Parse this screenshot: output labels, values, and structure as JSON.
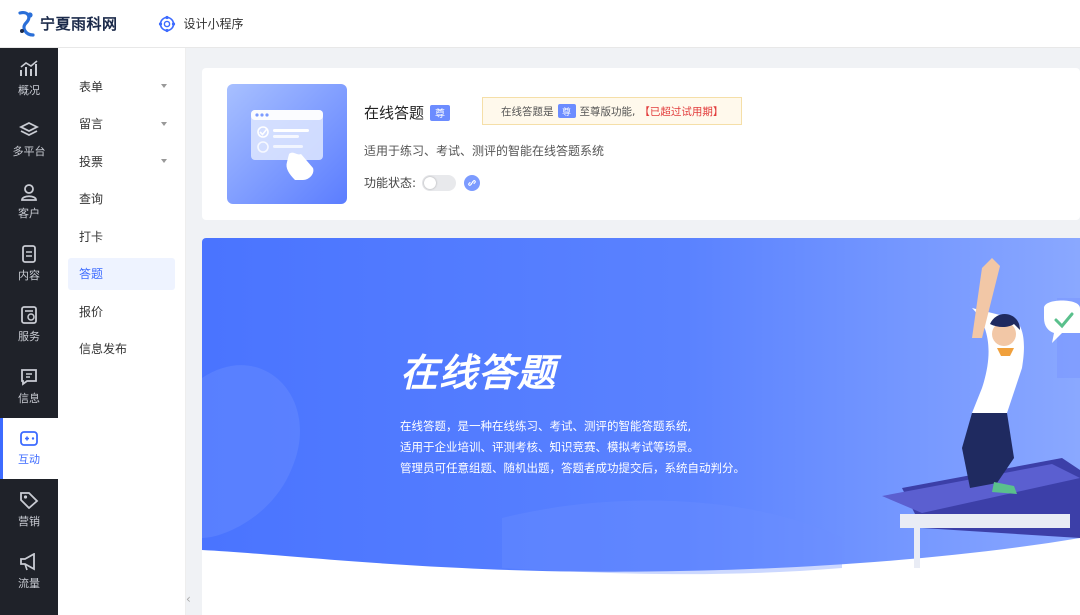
{
  "header": {
    "brand": "宁夏雨科网",
    "design_link": "设计小程序"
  },
  "sidebar": {
    "items": [
      {
        "label": "概况",
        "icon": "chart-icon"
      },
      {
        "label": "多平台",
        "icon": "layers-icon"
      },
      {
        "label": "客户",
        "icon": "user-icon"
      },
      {
        "label": "内容",
        "icon": "document-icon"
      },
      {
        "label": "服务",
        "icon": "service-icon"
      },
      {
        "label": "信息",
        "icon": "message-icon"
      },
      {
        "label": "互动",
        "icon": "gamepad-icon",
        "active": true
      },
      {
        "label": "营销",
        "icon": "tag-icon"
      },
      {
        "label": "流量",
        "icon": "megaphone-icon"
      }
    ]
  },
  "submenu": {
    "items": [
      {
        "label": "表单",
        "expandable": true
      },
      {
        "label": "留言",
        "expandable": true
      },
      {
        "label": "投票",
        "expandable": true
      },
      {
        "label": "查询"
      },
      {
        "label": "打卡"
      },
      {
        "label": "答题",
        "active": true
      },
      {
        "label": "报价"
      },
      {
        "label": "信息发布"
      }
    ],
    "collapse_glyph": "‹"
  },
  "feature": {
    "title": "在线答题",
    "vip_tag": "尊",
    "notice_prefix": "在线答题是",
    "notice_suffix": "至尊版功能,",
    "notice_expired": "【已超过试用期】",
    "description": "适用于练习、考试、测评的智能在线答题系统",
    "status_label": "功能状态:",
    "enabled": false
  },
  "banner": {
    "title": "在线答题",
    "lines": [
      "在线答题，是一种在线练习、考试、测评的智能答题系统,",
      "适用于企业培训、评测考核、知识竞赛、模拟考试等场景。",
      "管理员可任意组题、随机出题，答题者成功提交后，系统自动判分。"
    ]
  },
  "colors": {
    "primary": "#3d6bff",
    "sidebar_bg": "#1f2229",
    "banner_blue": "#4a74ff",
    "expired_red": "#e23c3c"
  }
}
